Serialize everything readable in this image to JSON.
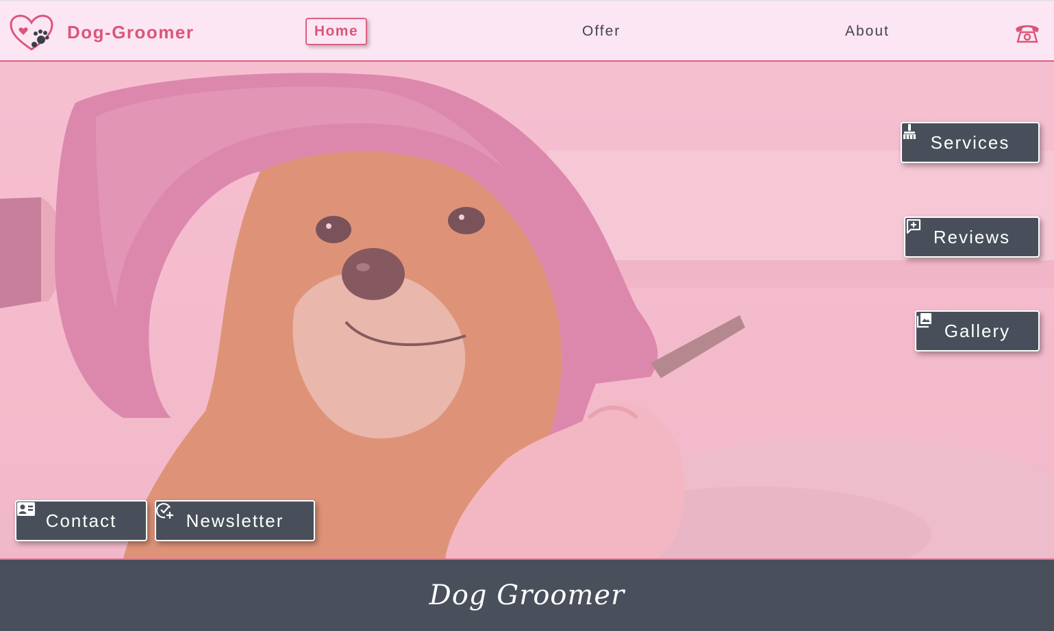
{
  "brand": {
    "name": "Dog-Groomer",
    "accent_color": "#d9567a",
    "logo_icon": "heart-paw-icon"
  },
  "nav": {
    "items": [
      {
        "label": "Home",
        "active": true
      },
      {
        "label": "Offer",
        "active": false
      },
      {
        "label": "About",
        "active": false
      }
    ],
    "phone_icon": "telephone-icon"
  },
  "hero": {
    "side_buttons": [
      {
        "label": "Services",
        "icon": "brush-icon"
      },
      {
        "label": "Reviews",
        "icon": "review-icon"
      },
      {
        "label": "Gallery",
        "icon": "gallery-icon"
      }
    ],
    "bottom_buttons": [
      {
        "label": "Contact",
        "icon": "contact-card-icon"
      },
      {
        "label": "Newsletter",
        "icon": "check-plus-icon"
      }
    ],
    "button_color": "#484f5a"
  },
  "footer": {
    "title": "Dog Groomer",
    "background": "#4a505b"
  }
}
